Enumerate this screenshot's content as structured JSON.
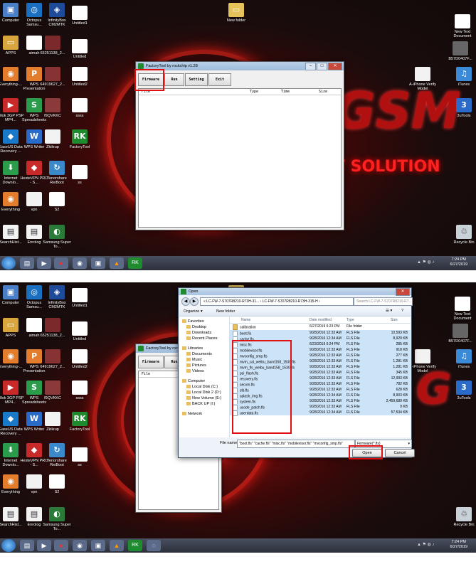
{
  "desktop_icons": [
    "Computer",
    "Octopus Samsu...",
    "InfinityBox CM2MTK",
    "Untitled1",
    "New folder",
    "New Text Document",
    "APPS",
    "aimah",
    "65251138_2...",
    "Untitled",
    "B57D0407F...",
    "Everything-...",
    "WPS Presentation",
    "64919627_2...",
    "Untitled2",
    "A-iPhone Verify Model",
    "iTunes",
    "Allok 3GP PSP MP4...",
    "WPS Spreadsheets",
    "f9QVKKC",
    "ssss",
    "3uTools",
    "EaseUS Data Recovery ...",
    "WPS Writer",
    "Zkileup",
    "FactoryTool",
    "Internet Downlo...",
    "HesteVPN PRO - S...",
    "Tenorshare ReiBoot",
    "ss",
    "Everything",
    "vpn",
    "S2",
    "SearchHist...",
    "Enrolog",
    "Samsung Super To...",
    "Recycle Bin"
  ],
  "brand": {
    "word": "GSM",
    "solution": "T SOLUTION"
  },
  "factory_tool": {
    "title": "FactoryTool by rockchip v1.28",
    "buttons": [
      "Firmware",
      "Run",
      "Setting",
      "Exit"
    ],
    "columns": [
      "File",
      "Type",
      "Time",
      "Size"
    ]
  },
  "open_dialog": {
    "title": "Open",
    "address": "« LC-FW-7-S707R8210-R73H-31... › LC-FW-7-S707R8210-R73H-315-H ›",
    "search_placeholder": "Search LC-FW-7-S707R8210-R7...",
    "toolbar": {
      "organize": "Organize ▾",
      "new_folder": "New folder"
    },
    "nav": [
      {
        "label": "Favorites",
        "level": 0
      },
      {
        "label": "Desktop",
        "level": 1
      },
      {
        "label": "Downloads",
        "level": 1
      },
      {
        "label": "Recent Places",
        "level": 1
      },
      {
        "label": "Libraries",
        "level": 0
      },
      {
        "label": "Documents",
        "level": 1
      },
      {
        "label": "Music",
        "level": 1
      },
      {
        "label": "Pictures",
        "level": 1
      },
      {
        "label": "Videos",
        "level": 1
      },
      {
        "label": "Computer",
        "level": 0
      },
      {
        "label": "Local Disk (C:)",
        "level": 1
      },
      {
        "label": "Local Disk 2 (D:)",
        "level": 1
      },
      {
        "label": "New Volume (E:)",
        "level": 1
      },
      {
        "label": "BACK UP (I:)",
        "level": 1
      },
      {
        "label": "Network",
        "level": 0
      }
    ],
    "columns": [
      "Name",
      "Date modified",
      "Type",
      "Size"
    ],
    "files": [
      {
        "name": "boot.fls",
        "date": "9/28/2016 12:33 AM",
        "type": "FLS File",
        "size": "10,593 KB"
      },
      {
        "name": "cache.fls",
        "date": "9/28/2016 12:34 AM",
        "type": "FLS File",
        "size": "8,929 KB"
      },
      {
        "name": "misc.fls",
        "date": "6/23/2019 6:24 PM",
        "type": "FLS File",
        "size": "285 KB"
      },
      {
        "name": "mobilevisor.fls",
        "date": "9/28/2016 12:33 AM",
        "type": "FLS File",
        "size": "918 KB"
      },
      {
        "name": "mvconfig_smp.fls",
        "date": "9/28/2016 12:33 AM",
        "type": "FLS File",
        "size": "277 KB"
      },
      {
        "name": "mvm_cal_weibu_band158_1530.fls",
        "date": "9/28/2016 12:33 AM",
        "type": "FLS File",
        "size": "1,281 KB"
      },
      {
        "name": "mvm_fls_weibu_band158_1530.fls",
        "date": "9/28/2016 12:33 AM",
        "type": "FLS File",
        "size": "1,281 KB"
      },
      {
        "name": "psi_flash.fls",
        "date": "9/28/2016 12:33 AM",
        "type": "FLS File",
        "size": "345 KB"
      },
      {
        "name": "recovery.fls",
        "date": "9/28/2016 12:33 AM",
        "type": "FLS File",
        "size": "12,993 KB"
      },
      {
        "name": "secvm.fls",
        "date": "9/28/2016 12:33 AM",
        "type": "FLS File",
        "size": "782 KB"
      },
      {
        "name": "slb.fls",
        "date": "9/28/2016 12:33 AM",
        "type": "FLS File",
        "size": "628 KB"
      },
      {
        "name": "splash_img.fls",
        "date": "9/28/2016 12:34 AM",
        "type": "FLS File",
        "size": "8,903 KB"
      },
      {
        "name": "system.fls",
        "date": "9/28/2016 12:33 AM",
        "type": "FLS File",
        "size": "2,459,689 KB"
      },
      {
        "name": "ucode_patch.fls",
        "date": "9/28/2016 12:33 AM",
        "type": "FLS File",
        "size": "9 KB"
      },
      {
        "name": "userdata.fls",
        "date": "9/28/2016 12:34 AM",
        "type": "FLS File",
        "size": "57,534 KB"
      }
    ],
    "folder": {
      "name": "calibration",
      "date": "6/27/2019 6:23 PM",
      "type": "File folder"
    },
    "filename_label": "File name:",
    "filename_value": "\"boot.fls\" \"cache.fls\" \"misc.fls\" \"mobilevisor.fls\" \"mvconfig_smp.fls\"",
    "filetype": "Firmware(*.fls)",
    "open_label": "Open",
    "cancel_label": "Cancel"
  },
  "clock": {
    "time": "7:24 PM",
    "date": "6/27/2019"
  }
}
